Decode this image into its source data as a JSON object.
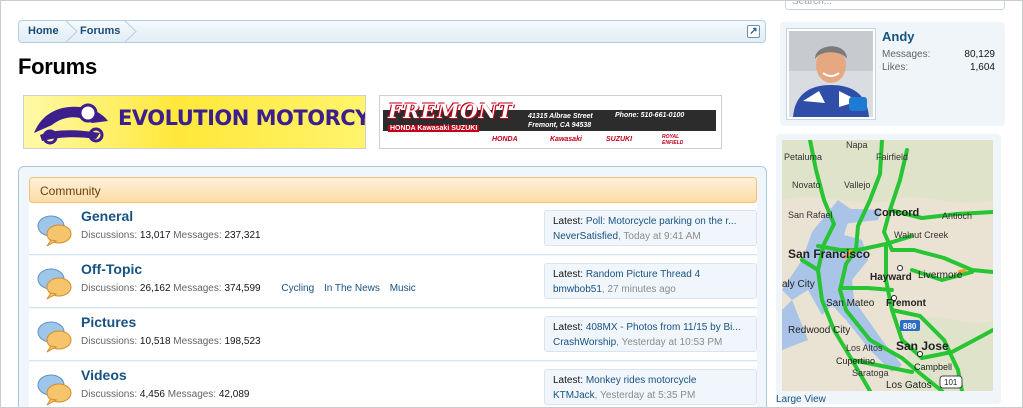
{
  "breadcrumb": {
    "home": "Home",
    "forums": "Forums"
  },
  "page": {
    "title": "Forums"
  },
  "ads": {
    "evolution": {
      "text": "EVOLUTION MOTORCYCLES"
    },
    "fremont": {
      "name": "FREMONT",
      "makes": "HONDA Kawasaki SUZUKI",
      "address_line1": "41315 Albrae Street",
      "address_line2": "Fremont, CA 94538",
      "phone": "Phone: 510-661-0100",
      "brands": [
        "HONDA",
        "Kawasaki",
        "SUZUKI",
        "ROYAL ENFIELD"
      ]
    }
  },
  "category": {
    "title": "Community"
  },
  "stats_labels": {
    "discussions": "Discussions:",
    "messages": "Messages:",
    "latest": "Latest:"
  },
  "nodes": [
    {
      "title": "General",
      "discussions": "13,017",
      "messages": "237,321",
      "subforums": [],
      "latest_title": "Poll: Motorcycle parking on the r...",
      "latest_user": "NeverSatisfied",
      "latest_time": "Today at 9:41 AM"
    },
    {
      "title": "Off-Topic",
      "discussions": "26,162",
      "messages": "374,599",
      "subforums": [
        "Cycling",
        "In The News",
        "Music"
      ],
      "latest_title": "Random Picture Thread 4",
      "latest_user": "bmwbob51",
      "latest_time": "27 minutes ago"
    },
    {
      "title": "Pictures",
      "discussions": "10,518",
      "messages": "198,523",
      "subforums": [],
      "latest_title": "408MX - Photos from 11/15 by Bi...",
      "latest_user": "CrashWorship",
      "latest_time": "Yesterday at 10:53 PM"
    },
    {
      "title": "Videos",
      "discussions": "4,456",
      "messages": "42,089",
      "subforums": [],
      "latest_title": "Monkey rides motorcycle",
      "latest_user": "KTMJack",
      "latest_time": "Yesterday at 5:35 PM"
    }
  ],
  "sidebar": {
    "search_placeholder": "Search...",
    "user": {
      "name": "Andy",
      "messages_label": "Messages:",
      "messages": "80,129",
      "likes_label": "Likes:",
      "likes": "1,604"
    },
    "map": {
      "large_view": "Large View",
      "places": [
        "Napa",
        "Fairfield",
        "Petaluma",
        "Novato",
        "Vallejo",
        "San Rafael",
        "Concord",
        "Antioch",
        "Walnut Creek",
        "San Francisco",
        "Hayward",
        "Livermore",
        "aly City",
        "San Mateo",
        "Fremont",
        "Redwood City",
        "Los Altos",
        "San Jose",
        "Cupertino",
        "Campbell",
        "Saratoga",
        "Los Gatos"
      ],
      "shields": [
        "880",
        "101"
      ]
    }
  },
  "colors": {
    "link": "#175283",
    "category_bg": "#fbdca5",
    "road": "#27c434"
  }
}
